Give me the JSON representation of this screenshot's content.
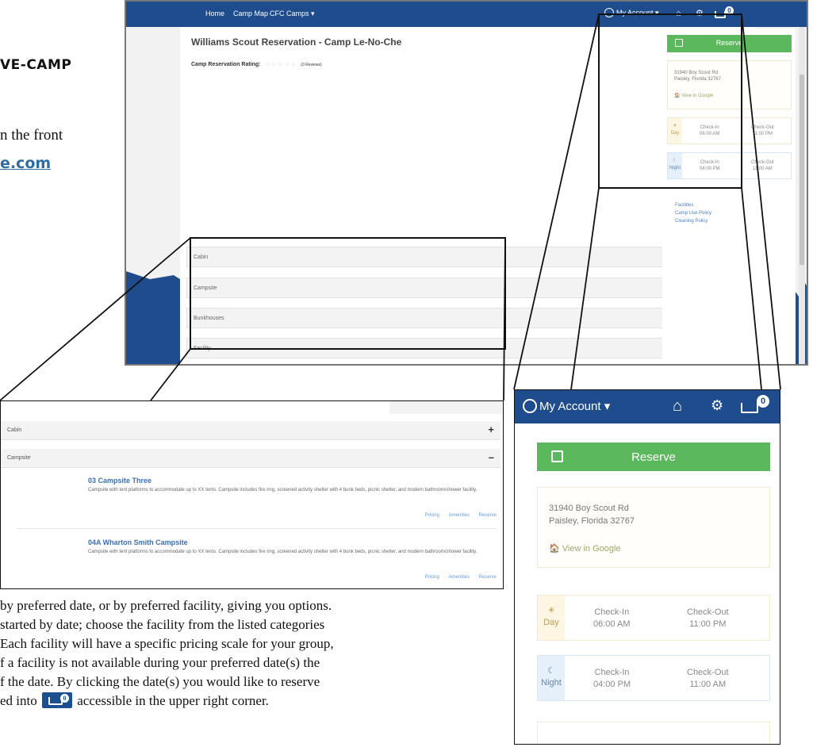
{
  "document": {
    "heading_fragment": "VE-CAMP",
    "line_fragment": "n the front",
    "link_fragment": "e.com",
    "paragraph_lines": [
      "by preferred date, or by preferred facility, giving you options.",
      "started by date; choose the facility from the listed categories",
      "Each facility will have a specific pricing scale for your group,",
      "f a facility is not available during your preferred date(s) the",
      "f the date.  By clicking the date(s) you would like to reserve"
    ],
    "last_line_before": "ed into ",
    "last_line_after": " accessible in the upper right corner.",
    "cart_count": "0"
  },
  "nav": {
    "home": "Home",
    "camp_map": "Camp Map",
    "cfc_camps": "CFC Camps ▾",
    "my_account": "My Account ▾",
    "cart_count": "0"
  },
  "camp": {
    "title": "Williams Scout Reservation - Camp Le-No-Che",
    "rating_label": "Camp Reservation Rating:",
    "stars": "☆☆☆☆☆",
    "reviews": "(0 Reviews)"
  },
  "categories": [
    "Cabin",
    "Campsite",
    "Bunkhouses",
    "Facility"
  ],
  "sidebar": {
    "reserve_label": "Reserve",
    "address_line1": "31940 Boy Scout Rd",
    "address_line2": "Paisley, Florida 32767",
    "google_link": "View in Google",
    "day": {
      "label": "Day",
      "check_in_label": "Check-In",
      "check_in_time": "06:00 AM",
      "check_out_label": "Check-Out",
      "check_out_time": "11:00 PM"
    },
    "night": {
      "label": "Night",
      "check_in_label": "Check-In",
      "check_in_time": "04:00 PM",
      "check_out_label": "Check-Out",
      "check_out_time": "11:00 AM"
    },
    "links": [
      "Facilities",
      "Camp Use Policy",
      "Cleaning Policy"
    ]
  },
  "inset": {
    "cabin": "Cabin",
    "campsite": "Campsite",
    "sites": [
      {
        "name": "03 Campsite Three",
        "description": "Campsite with tent platforms to accommodate up to XX tents. Campsite includes fire ring, screened activity shelter with 4 bunk beds, picnic shelter, and modern bathroom/shower facility.",
        "actions": [
          "Pricing",
          "Amenities",
          "Reserve"
        ]
      },
      {
        "name": "04A Wharton Smith Campsite",
        "description": "Campsite with tent platforms to accommodate up to XX tents. Campsite includes fire ring, screened activity shelter with 4 bunk beds, picnic shelter, and modern bathroom/shower facility.",
        "actions": [
          "Pricing",
          "Amenities",
          "Reserve"
        ]
      }
    ]
  },
  "colors": {
    "nav_blue": "#1f4c8c",
    "reserve_green": "#5cb85c",
    "link_blue": "#3a70b6",
    "mountain_blue": "#1f4c8c"
  }
}
